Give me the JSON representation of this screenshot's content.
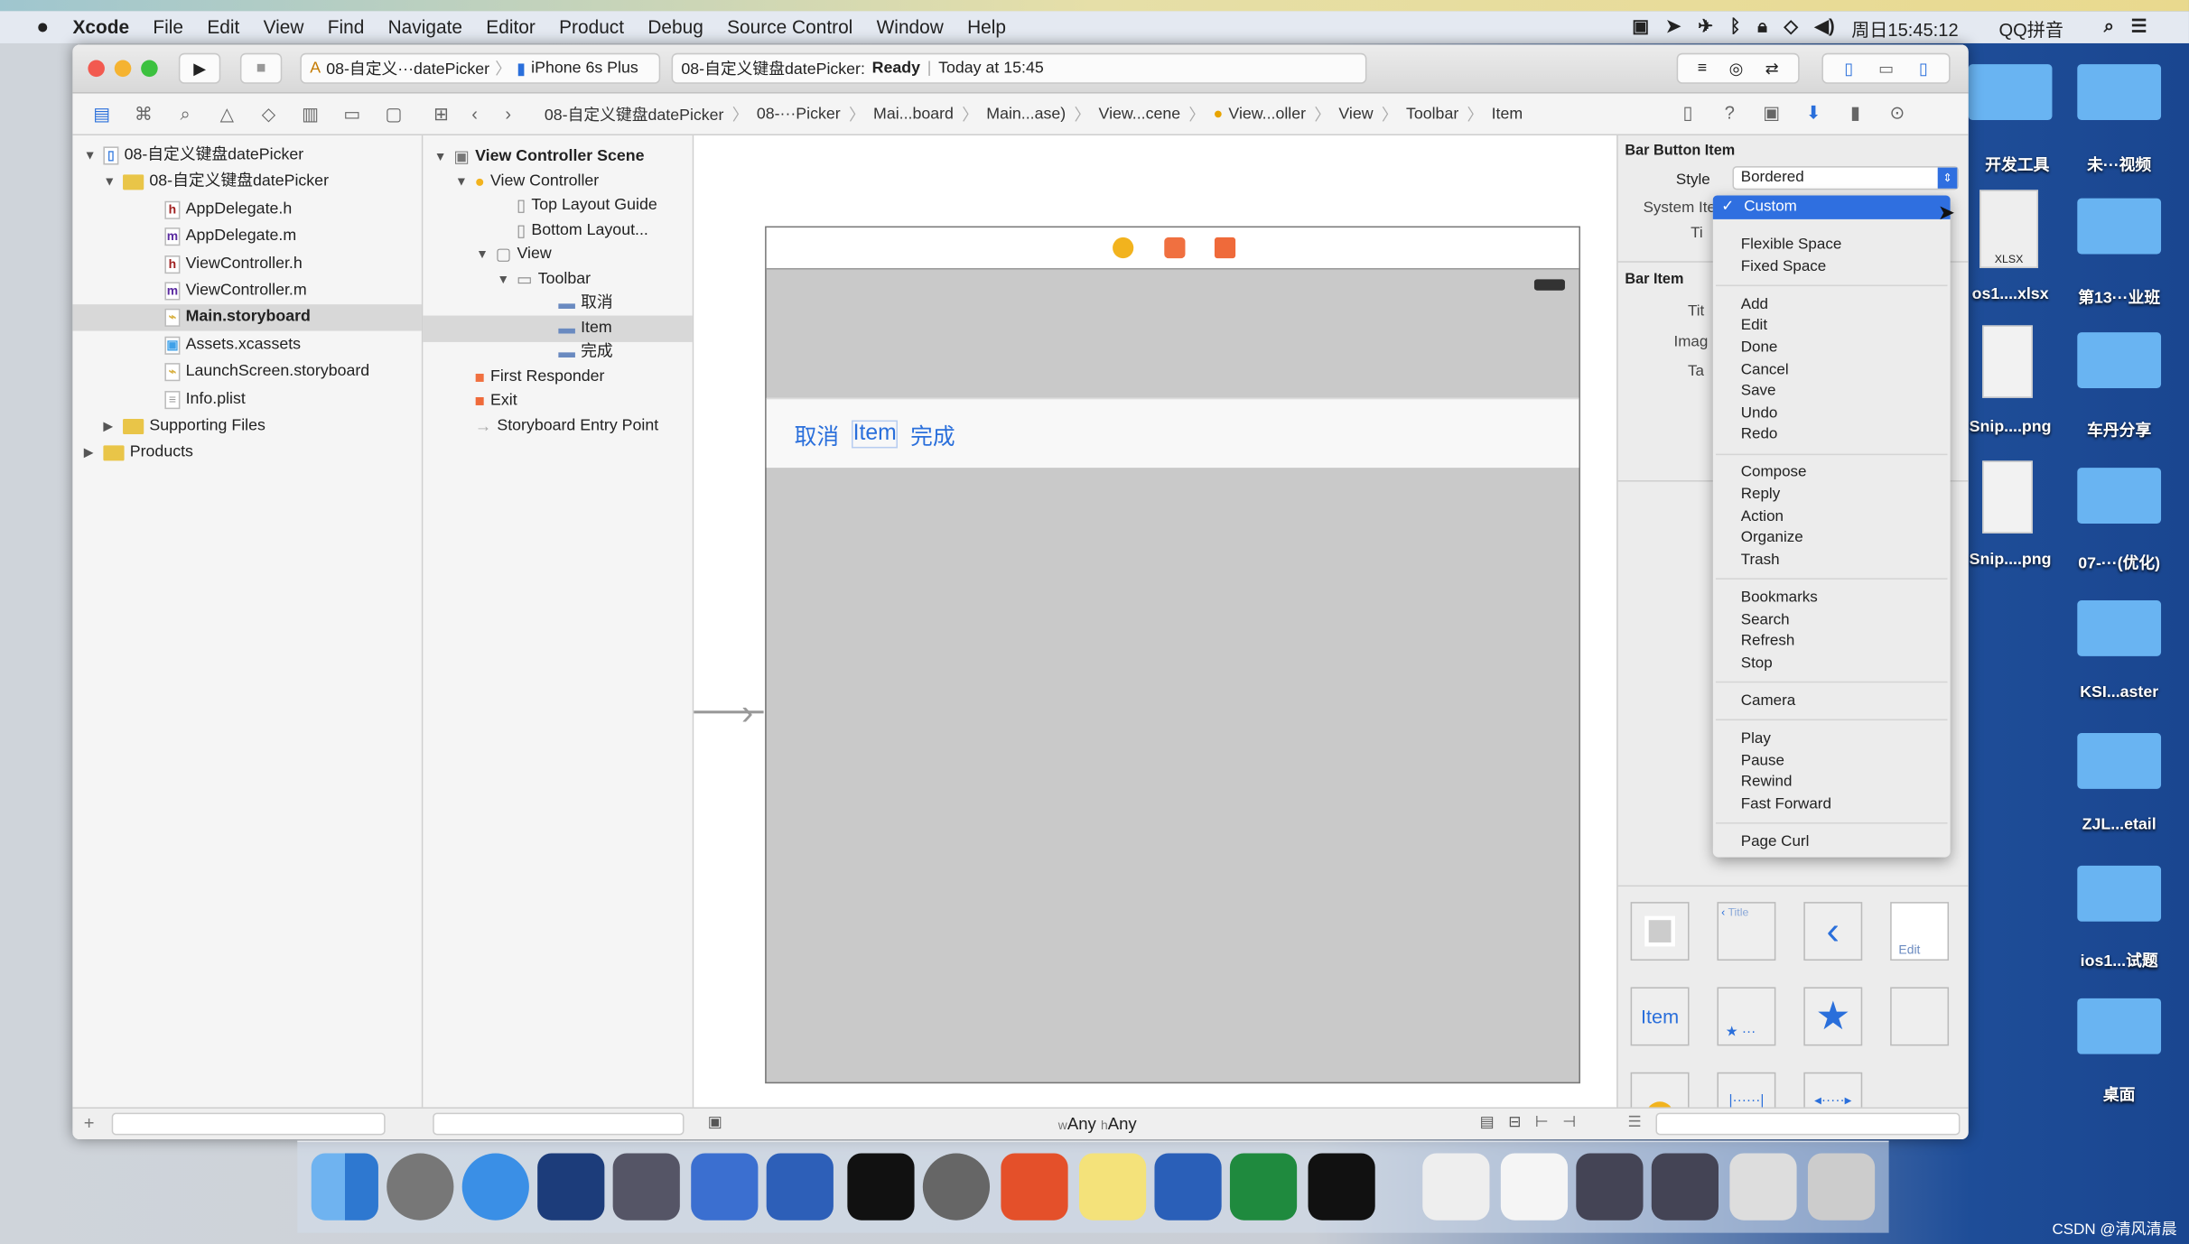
{
  "menubar": {
    "apple": "",
    "items": [
      "Xcode",
      "File",
      "Edit",
      "View",
      "Find",
      "Navigate",
      "Editor",
      "Product",
      "Debug",
      "Source Control",
      "Window",
      "Help"
    ],
    "clock": "周日15:45:12",
    "ime": "QQ拼音"
  },
  "toolbar": {
    "scheme": "08-自定义···datePicker",
    "device": "iPhone 6s Plus",
    "status_project": "08-自定义键盘datePicker:",
    "status_state": "Ready",
    "status_time": "Today at 15:45"
  },
  "breadcrumb": [
    "08-自定义键盘datePicker",
    "08-···Picker",
    "Mai...board",
    "Main...ase)",
    "View...cene",
    "View...oller",
    "View",
    "Toolbar",
    "Item"
  ],
  "navigator": {
    "items": [
      {
        "label": "08-自定义键盘datePicker",
        "icon": "project"
      },
      {
        "label": "08-自定义键盘datePicker",
        "icon": "folder"
      },
      {
        "label": "AppDelegate.h",
        "icon": "h"
      },
      {
        "label": "AppDelegate.m",
        "icon": "m"
      },
      {
        "label": "ViewController.h",
        "icon": "h"
      },
      {
        "label": "ViewController.m",
        "icon": "m"
      },
      {
        "label": "Main.storyboard",
        "icon": "storyboard",
        "selected": true
      },
      {
        "label": "Assets.xcassets",
        "icon": "assets"
      },
      {
        "label": "LaunchScreen.storyboard",
        "icon": "storyboard"
      },
      {
        "label": "Info.plist",
        "icon": "plist"
      },
      {
        "label": "Supporting Files",
        "icon": "folder"
      },
      {
        "label": "Products",
        "icon": "folder"
      }
    ]
  },
  "outline": {
    "items": [
      "View Controller Scene",
      "View Controller",
      "Top Layout Guide",
      "Bottom Layout...",
      "View",
      "Toolbar",
      "取消",
      "Item",
      "完成",
      "First Responder",
      "Exit",
      "Storyboard Entry Point"
    ],
    "selected": "Item"
  },
  "canvas": {
    "toolbar_items": [
      "取消",
      "Item",
      "完成"
    ],
    "size_class_w": "w",
    "size_class_w_val": "Any",
    "size_class_h": "h",
    "size_class_h_val": "Any"
  },
  "inspector": {
    "section1": "Bar Button Item",
    "style_label": "Style",
    "style_value": "Bordered",
    "system_item_label": "System Ite",
    "tint_label": "Ti",
    "section2": "Bar Item",
    "title_label": "Tit",
    "image_label": "Imag",
    "tag_label": "Ta"
  },
  "dropdown": {
    "selected": "Custom",
    "groups": [
      [
        "Flexible Space",
        "Fixed Space"
      ],
      [
        "Add",
        "Edit",
        "Done",
        "Cancel",
        "Save",
        "Undo",
        "Redo"
      ],
      [
        "Compose",
        "Reply",
        "Action",
        "Organize",
        "Trash"
      ],
      [
        "Bookmarks",
        "Search",
        "Refresh",
        "Stop"
      ],
      [
        "Camera"
      ],
      [
        "Play",
        "Pause",
        "Rewind",
        "Fast Forward"
      ],
      [
        "Page Curl"
      ]
    ]
  },
  "library": {
    "title_label": "Title",
    "edit_label": "Edit",
    "item_label": "Item"
  },
  "desktop": [
    "开发工具",
    "未···视频",
    "os1....xlsx",
    "第13···业班",
    "Snip....png",
    "车丹分享",
    "Snip....png",
    "07-···(优化)",
    "KSI...aster",
    "ZJL...etail",
    "ios1...试题",
    "桌面"
  ],
  "xlsx_label": "XLSX",
  "watermark": "CSDN @清风清晨",
  "colors": {
    "accent": "#2a6fdb",
    "selection": "#2f6fe0",
    "folder": "#69b4f2"
  }
}
